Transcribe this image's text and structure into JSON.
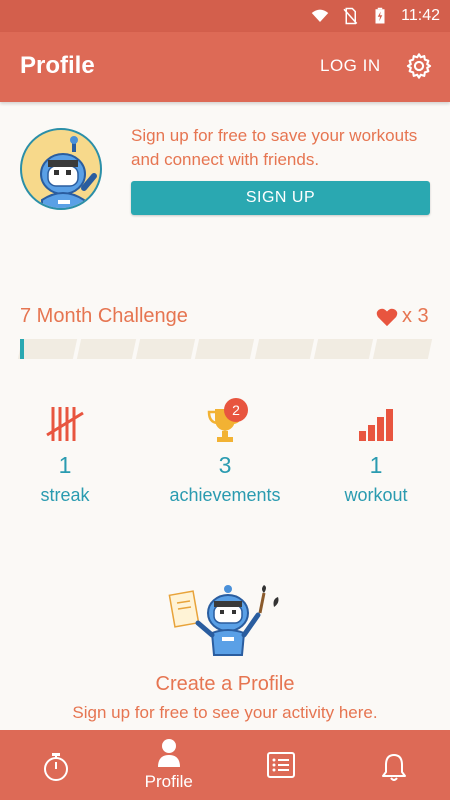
{
  "status_bar": {
    "time": "11:42"
  },
  "app_bar": {
    "title": "Profile",
    "login_label": "LOG IN"
  },
  "signup": {
    "message": "Sign up for free to save your workouts and connect with friends.",
    "button_label": "SIGN UP"
  },
  "challenge": {
    "title": "7 Month Challenge",
    "lives_text": "x 3",
    "segments": 7,
    "progress_fraction": 0.01
  },
  "stats": [
    {
      "value": "1",
      "label": "streak",
      "icon": "tally-icon"
    },
    {
      "value": "3",
      "label": "achievements",
      "icon": "trophy-icon",
      "badge": "2"
    },
    {
      "value": "1",
      "label": "workout",
      "icon": "bar-chart-icon"
    }
  ],
  "empty_state": {
    "title": "Create a Profile",
    "subtitle": "Sign up for free to see your activity here."
  },
  "bottom_nav": [
    {
      "name": "timer",
      "label": "",
      "icon": "stopwatch-icon"
    },
    {
      "name": "profile",
      "label": "Profile",
      "icon": "person-icon",
      "active": true
    },
    {
      "name": "list",
      "label": "",
      "icon": "list-icon"
    },
    {
      "name": "notifications",
      "label": "",
      "icon": "bell-icon"
    }
  ],
  "colors": {
    "primary": "#dd6a56",
    "accent": "#2aa8b1",
    "text_orange": "#e67551",
    "text_teal": "#2a9bb0",
    "badge": "#e8553f"
  }
}
